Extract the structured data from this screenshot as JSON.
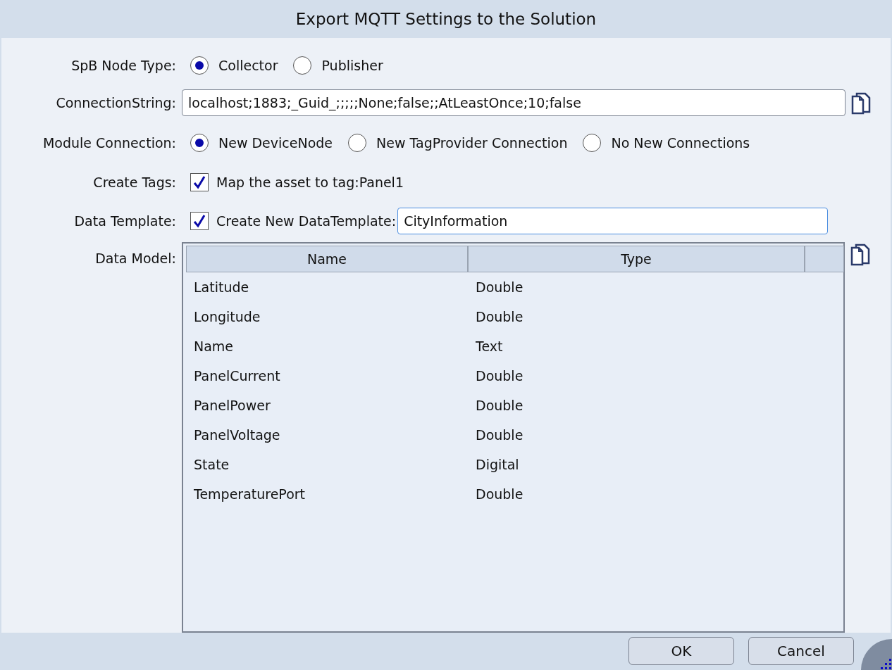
{
  "window": {
    "title": "Export MQTT Settings to the Solution"
  },
  "node_type": {
    "label": "SpB Node Type:",
    "options": [
      {
        "label": "Collector",
        "selected": true
      },
      {
        "label": "Publisher",
        "selected": false
      }
    ]
  },
  "connection_string": {
    "label": "ConnectionString:",
    "value": "localhost;1883;_Guid_;;;;;None;false;;AtLeastOnce;10;false"
  },
  "module_connection": {
    "label": "Module Connection:",
    "options": [
      {
        "label": "New DeviceNode",
        "selected": true
      },
      {
        "label": "New TagProvider Connection",
        "selected": false
      },
      {
        "label": "No New Connections",
        "selected": false
      }
    ]
  },
  "create_tags": {
    "label": "Create Tags:",
    "checkbox": {
      "label": "Map the asset to tag:Panel1",
      "checked": true
    }
  },
  "data_template": {
    "label": "Data Template:",
    "checkbox": {
      "label": "Create New DataTemplate:",
      "checked": true
    },
    "value": "CityInformation"
  },
  "data_model": {
    "label": "Data Model:",
    "columns": [
      "Name",
      "Type"
    ],
    "rows": [
      [
        "Latitude",
        "Double"
      ],
      [
        "Longitude",
        "Double"
      ],
      [
        "Name",
        "Text"
      ],
      [
        "PanelCurrent",
        "Double"
      ],
      [
        "PanelPower",
        "Double"
      ],
      [
        "PanelVoltage",
        "Double"
      ],
      [
        "State",
        "Digital"
      ],
      [
        "TemperaturePort",
        "Double"
      ]
    ]
  },
  "buttons": [
    "OK",
    "Cancel"
  ]
}
